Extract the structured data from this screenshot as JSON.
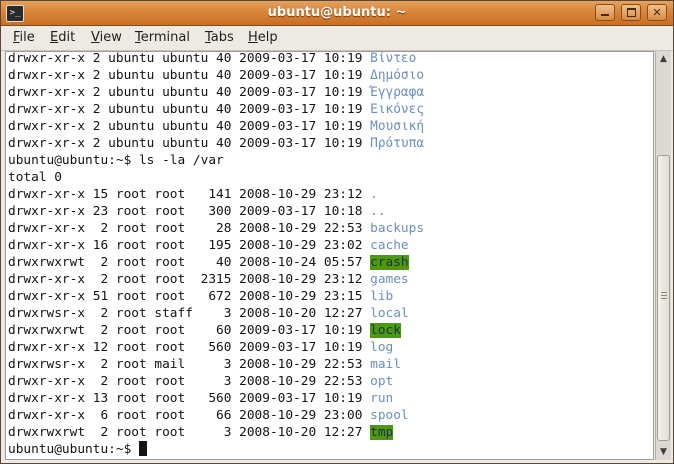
{
  "window": {
    "title": "ubuntu@ubuntu: ~",
    "app_icon_glyph": ">_",
    "controls": {
      "minimize": "minimize",
      "maximize": "maximize",
      "close": "✕"
    }
  },
  "menubar": {
    "items": [
      {
        "label": "File",
        "underline": "F",
        "rest": "ile"
      },
      {
        "label": "Edit",
        "underline": "E",
        "rest": "dit"
      },
      {
        "label": "View",
        "underline": "V",
        "rest": "iew"
      },
      {
        "label": "Terminal",
        "underline": "T",
        "rest": "erminal"
      },
      {
        "label": "Tabs",
        "underline": "T",
        "rest": "abs"
      },
      {
        "label": "Help",
        "underline": "H",
        "rest": "elp"
      }
    ]
  },
  "terminal": {
    "colors": {
      "text": "#141414",
      "directory": "#6d8fbe",
      "sticky_other_writable_bg": "#4e9a06",
      "sticky_other_writable_fg": "#1a2d66"
    },
    "lines": [
      {
        "text": "drwxr-xr-x 2 ubuntu ubuntu 40 2009-03-17 10:19 ",
        "name": "Βίντεο",
        "style": "dir"
      },
      {
        "text": "drwxr-xr-x 2 ubuntu ubuntu 40 2009-03-17 10:19 ",
        "name": "Δημόσιο",
        "style": "dir"
      },
      {
        "text": "drwxr-xr-x 2 ubuntu ubuntu 40 2009-03-17 10:19 ",
        "name": "Έγγραφα",
        "style": "dir"
      },
      {
        "text": "drwxr-xr-x 2 ubuntu ubuntu 40 2009-03-17 10:19 ",
        "name": "Εικόνες",
        "style": "dir"
      },
      {
        "text": "drwxr-xr-x 2 ubuntu ubuntu 40 2009-03-17 10:19 ",
        "name": "Μουσική",
        "style": "dir"
      },
      {
        "text": "drwxr-xr-x 2 ubuntu ubuntu 40 2009-03-17 10:19 ",
        "name": "Πρότυπα",
        "style": "dir"
      },
      {
        "text": "ubuntu@ubuntu:~$ ls -la /var",
        "name": "",
        "style": "plain"
      },
      {
        "text": "total 0",
        "name": "",
        "style": "plain"
      },
      {
        "text": "drwxr-xr-x 15 root root   141 2008-10-29 23:12 ",
        "name": ".",
        "style": "dir"
      },
      {
        "text": "drwxr-xr-x 23 root root   300 2009-03-17 10:18 ",
        "name": "..",
        "style": "dir"
      },
      {
        "text": "drwxr-xr-x  2 root root    28 2008-10-29 22:53 ",
        "name": "backups",
        "style": "dir"
      },
      {
        "text": "drwxr-xr-x 16 root root   195 2008-10-29 23:02 ",
        "name": "cache",
        "style": "dir"
      },
      {
        "text": "drwxrwxrwt  2 root root    40 2008-10-24 05:57 ",
        "name": "crash",
        "style": "hl"
      },
      {
        "text": "drwxr-xr-x  2 root root  2315 2008-10-29 23:12 ",
        "name": "games",
        "style": "dir"
      },
      {
        "text": "drwxr-xr-x 51 root root   672 2008-10-29 23:15 ",
        "name": "lib",
        "style": "dir"
      },
      {
        "text": "drwxrwsr-x  2 root staff    3 2008-10-20 12:27 ",
        "name": "local",
        "style": "dir"
      },
      {
        "text": "drwxrwxrwt  2 root root    60 2009-03-17 10:19 ",
        "name": "lock",
        "style": "hl"
      },
      {
        "text": "drwxr-xr-x 12 root root   560 2009-03-17 10:19 ",
        "name": "log",
        "style": "dir"
      },
      {
        "text": "drwxrwsr-x  2 root mail     3 2008-10-29 22:53 ",
        "name": "mail",
        "style": "dir"
      },
      {
        "text": "drwxr-xr-x  2 root root     3 2008-10-29 22:53 ",
        "name": "opt",
        "style": "dir"
      },
      {
        "text": "drwxr-xr-x 13 root root   560 2009-03-17 10:19 ",
        "name": "run",
        "style": "dir"
      },
      {
        "text": "drwxr-xr-x  6 root root    66 2008-10-29 23:00 ",
        "name": "spool",
        "style": "dir"
      },
      {
        "text": "drwxrwxrwt  2 root root     3 2008-10-20 12:27 ",
        "name": "tmp",
        "style": "hl"
      },
      {
        "text": "ubuntu@ubuntu:~$ ",
        "name": "",
        "style": "prompt"
      }
    ]
  },
  "scrollbar": {
    "up_icon": "▲",
    "down_icon": "▼"
  }
}
